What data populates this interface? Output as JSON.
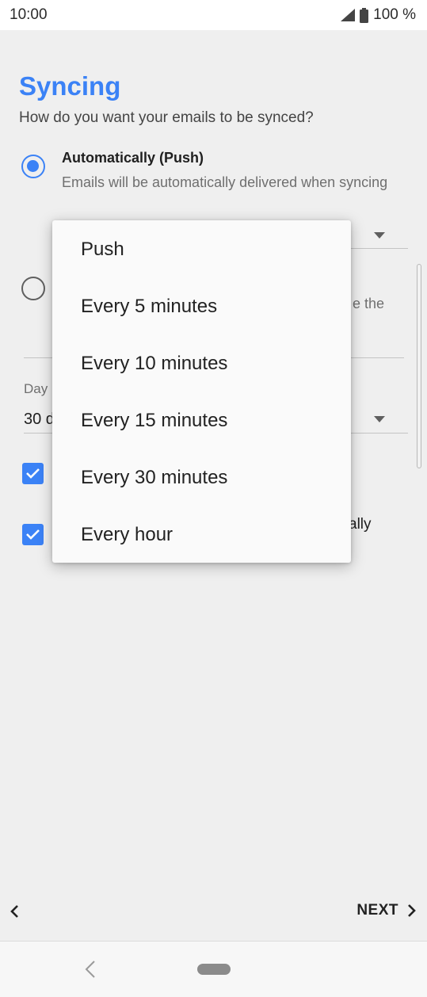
{
  "status_bar": {
    "time": "10:00",
    "battery": "100 %"
  },
  "page": {
    "title": "Syncing",
    "subtitle": "How do you want your emails to be synced?"
  },
  "options": {
    "push": {
      "title": "Automatically (Push)",
      "description": "Emails will be automatically delivered when syncing",
      "selected": true
    },
    "manual": {
      "selected": false,
      "partial_text": "e the"
    }
  },
  "partial_labels": {
    "days_label": "Day",
    "days_value": "30 d",
    "checkbox_text": "ally"
  },
  "checkboxes": [
    {
      "checked": true
    },
    {
      "checked": true
    }
  ],
  "dropdown": {
    "items": [
      "Push",
      "Every 5 minutes",
      "Every 10 minutes",
      "Every 15 minutes",
      "Every 30 minutes",
      "Every hour"
    ]
  },
  "footer": {
    "next_label": "NEXT"
  },
  "colors": {
    "accent": "#3b82f6",
    "background": "#efefef",
    "menu": "#fafafa"
  },
  "icons": [
    "signal-icon",
    "battery-icon",
    "chevron-left-icon",
    "chevron-right-icon",
    "dropdown-caret-icon",
    "checkmark-icon",
    "nav-back-icon",
    "nav-home-pill"
  ]
}
